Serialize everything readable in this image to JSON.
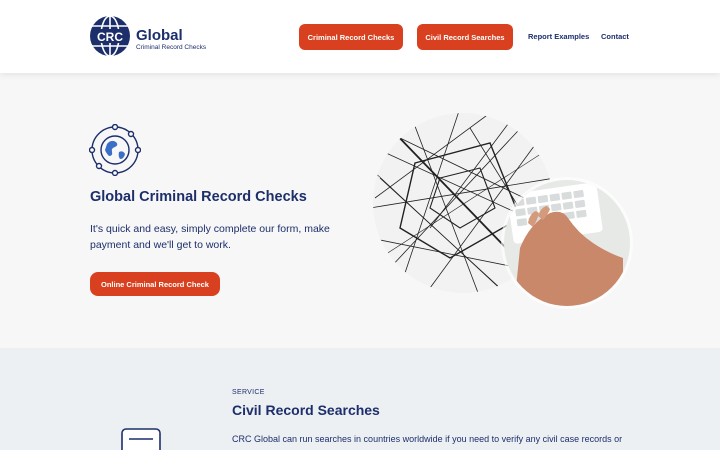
{
  "brand": {
    "logo_mark": "CRC",
    "logo_word": "Global",
    "logo_sub": "Criminal Record Checks",
    "primary_color": "#1c2f6b",
    "accent_color": "#d8401f"
  },
  "nav": {
    "criminal_label": "Criminal Record Checks",
    "civil_label": "Civil Record Searches",
    "report_label": "Report Examples",
    "contact_label": "Contact"
  },
  "hero": {
    "icon": "globe-network-icon",
    "title": "Global Criminal Record Checks",
    "text": "It's quick and easy, simply complete our form, make payment and we'll get to work.",
    "button_label": "Online Criminal Record Check",
    "images": [
      "network-lines-image",
      "typing-keyboard-image"
    ]
  },
  "service": {
    "kicker": "SERVICE",
    "title": "Civil Record Searches",
    "text": "CRC Global can run searches in countries worldwide if you need to verify any civil case records or",
    "icon": "document-icon"
  }
}
